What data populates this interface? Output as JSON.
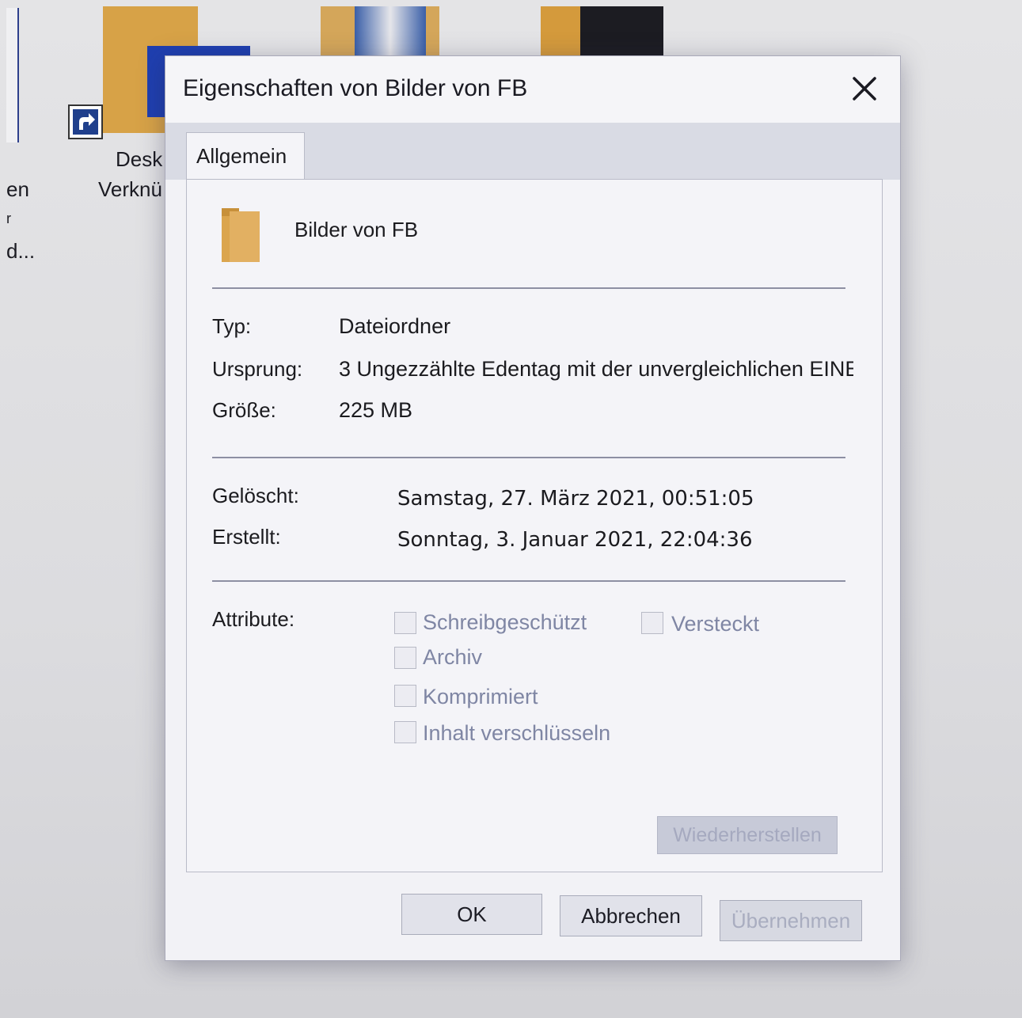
{
  "desktop": {
    "label_left_1": "en",
    "label_left_2": "r",
    "label_left_3": "d...",
    "label_shortcut_1": "Desk",
    "label_shortcut_2": "Verknü"
  },
  "dialog": {
    "title": "Eigenschaften von Bilder von FB",
    "close_label": "×",
    "tab": "Allgemein",
    "folder_name": "Bilder von FB",
    "info": {
      "type_label": "Typ:",
      "type_value": "Dateiordner",
      "origin_label": "Ursprung:",
      "origin_value": "3 Ungezzählte Edentag mit der unvergleichlichen EINE",
      "size_label": "Größe:",
      "size_value": "225 MB"
    },
    "dates": {
      "deleted_label": "Gelöscht:",
      "deleted_value": "Samstag, 27. März 2021, 00:51:05",
      "created_label": "Erstellt:",
      "created_value": "Sonntag, 3. Januar 2021, 22:04:36"
    },
    "attributes": {
      "label": "Attribute:",
      "readonly": "Schreibgeschützt",
      "hidden": "Versteckt",
      "archive": "Archiv",
      "compressed": "Komprimiert",
      "encrypt": "Inhalt verschlüsseln"
    },
    "restore_button": "Wiederherstellen",
    "buttons": {
      "ok": "OK",
      "cancel": "Abbrechen",
      "apply": "Übernehmen"
    }
  }
}
